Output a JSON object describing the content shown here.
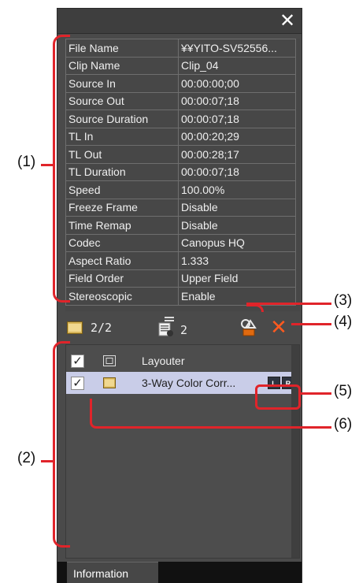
{
  "window": {
    "close_glyph": "✕"
  },
  "properties": [
    {
      "key": "File Name",
      "value": "¥¥YITO-SV52556..."
    },
    {
      "key": "Clip Name",
      "value": "Clip_04"
    },
    {
      "key": "Source In",
      "value": "00:00:00;00"
    },
    {
      "key": "Source Out",
      "value": "00:00:07;18"
    },
    {
      "key": "Source Duration",
      "value": "00:00:07;18"
    },
    {
      "key": "TL In",
      "value": "00:00:20;29"
    },
    {
      "key": "TL Out",
      "value": "00:00:28;17"
    },
    {
      "key": "TL Duration",
      "value": "00:00:07;18"
    },
    {
      "key": "Speed",
      "value": "100.00%"
    },
    {
      "key": "Freeze Frame",
      "value": "Disable"
    },
    {
      "key": "Time Remap",
      "value": "Disable"
    },
    {
      "key": "Codec",
      "value": "Canopus HQ"
    },
    {
      "key": "Aspect Ratio",
      "value": "1.333"
    },
    {
      "key": "Field Order",
      "value": "Upper Field"
    },
    {
      "key": "Stereoscopic",
      "value": "Enable"
    }
  ],
  "toolbar": {
    "clip_count": "2/2",
    "filter_count": "2"
  },
  "effects": [
    {
      "label": "Layouter",
      "checked": true,
      "selected": false,
      "icon": "layouter-icon"
    },
    {
      "label": "3-Way Color Corr...",
      "checked": true,
      "selected": true,
      "icon": "filter-icon",
      "lr": [
        "L",
        "R"
      ]
    }
  ],
  "tabs": [
    {
      "label": "Information"
    }
  ],
  "callouts": [
    "(1)",
    "(2)",
    "(3)",
    "(4)",
    "(5)",
    "(6)"
  ],
  "colors": {
    "callout_red": "#e0242a",
    "delete_orange": "#ff5a1f",
    "selection": "#c9cde8"
  }
}
